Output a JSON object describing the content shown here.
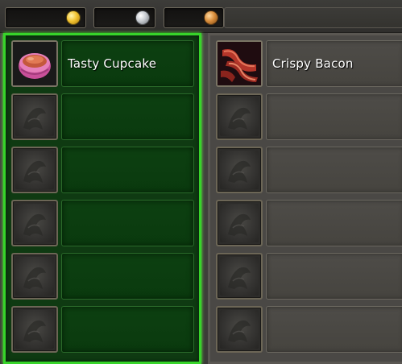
{
  "money": {
    "gold_icon": "gold-coin",
    "silver_icon": "silver-coin",
    "copper_icon": "copper-coin",
    "colors": {
      "gold": "#f2c431",
      "silver": "#c7cbd0",
      "copper": "#d98e3c"
    }
  },
  "player_trade": {
    "accepted": true,
    "highlight_color": "#37d42a",
    "slots": [
      {
        "name": "Tasty Cupcake",
        "icon": "cupcake-icon"
      },
      {
        "name": "",
        "icon": "empty-slot-icon"
      },
      {
        "name": "",
        "icon": "empty-slot-icon"
      },
      {
        "name": "",
        "icon": "empty-slot-icon"
      },
      {
        "name": "",
        "icon": "empty-slot-icon"
      },
      {
        "name": "",
        "icon": "empty-slot-icon"
      }
    ]
  },
  "target_trade": {
    "accepted": false,
    "slots": [
      {
        "name": "Crispy Bacon",
        "icon": "bacon-icon"
      },
      {
        "name": "",
        "icon": "empty-slot-icon"
      },
      {
        "name": "",
        "icon": "empty-slot-icon"
      },
      {
        "name": "",
        "icon": "empty-slot-icon"
      },
      {
        "name": "",
        "icon": "empty-slot-icon"
      },
      {
        "name": "",
        "icon": "empty-slot-icon"
      }
    ]
  }
}
